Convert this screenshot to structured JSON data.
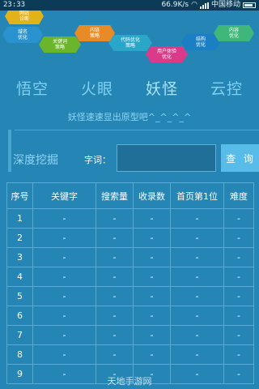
{
  "status_bar": {
    "time": "23:33",
    "speed": "66.9K/s",
    "carrier": "中国移动"
  },
  "banner": {
    "hexes": [
      {
        "text": "网站\n诊断",
        "color": "#e2b318"
      },
      {
        "text": "域名\n优化",
        "color": "#2a93cf"
      },
      {
        "text": "关键词\n策略",
        "color": "#6ab52c"
      },
      {
        "text": "内链\n策略",
        "color": "#e88b26"
      },
      {
        "text": "代码优化\n策略",
        "color": "#2aa6c9"
      },
      {
        "text": "用户体验\n优化",
        "color": "#d93a8a"
      },
      {
        "text": "结构\n优化",
        "color": "#1b7fc4"
      },
      {
        "text": "内容\n优化",
        "color": "#3fb77a"
      }
    ]
  },
  "tabs": [
    {
      "label": "悟空"
    },
    {
      "label": "火眼"
    },
    {
      "label": "妖怪"
    },
    {
      "label": "云控"
    }
  ],
  "hint": "妖怪速速显出原型吧^_^_^_^",
  "dig": {
    "title": "深度挖掘",
    "word_label": "字词：",
    "input_value": "",
    "query_label": "查 询"
  },
  "table": {
    "headers": [
      "序号",
      "关键字",
      "搜索量",
      "收录数",
      "首页第1位",
      "难度"
    ],
    "rows": [
      [
        "1",
        "-",
        "-",
        "-",
        "-",
        "-"
      ],
      [
        "2",
        "-",
        "-",
        "-",
        "-",
        "-"
      ],
      [
        "3",
        "-",
        "-",
        "-",
        "-",
        "-"
      ],
      [
        "4",
        "-",
        "-",
        "-",
        "-",
        "-"
      ],
      [
        "5",
        "-",
        "-",
        "-",
        "-",
        "-"
      ],
      [
        "6",
        "-",
        "-",
        "-",
        "-",
        "-"
      ],
      [
        "7",
        "-",
        "-",
        "-",
        "-",
        "-"
      ],
      [
        "8",
        "-",
        "-",
        "-",
        "-",
        "-"
      ],
      [
        "9",
        "-",
        "-",
        "-",
        "-",
        "-"
      ]
    ]
  },
  "watermark": "天地手游网"
}
